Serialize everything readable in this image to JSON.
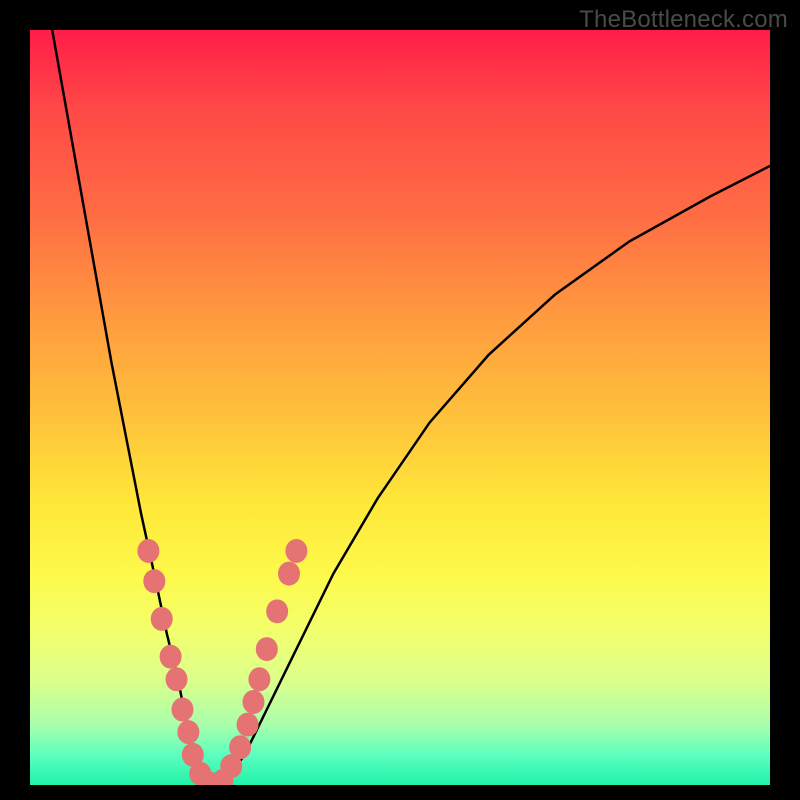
{
  "watermark": "TheBottleneck.com",
  "colors": {
    "background": "#000000",
    "curve_stroke": "#000000",
    "marker_fill": "#e57374",
    "gradient_top": "#ff1d48",
    "gradient_mid": "#ffe83a",
    "gradient_bottom": "#20f2a9"
  },
  "chart_data": {
    "type": "line",
    "title": "",
    "xlabel": "",
    "ylabel": "",
    "xlim": [
      0,
      100
    ],
    "ylim": [
      0,
      100
    ],
    "series": [
      {
        "name": "curve",
        "x": [
          3,
          5,
          7,
          9,
          11,
          13,
          15,
          17,
          18.5,
          20,
          21,
          22,
          23,
          24,
          26,
          29,
          32,
          36,
          41,
          47,
          54,
          62,
          71,
          81,
          92,
          100
        ],
        "y": [
          100,
          89,
          78,
          67,
          56,
          46,
          36,
          27,
          20,
          14,
          9,
          5,
          2,
          0,
          0,
          4,
          10,
          18,
          28,
          38,
          48,
          57,
          65,
          72,
          78,
          82
        ]
      }
    ],
    "markers": [
      {
        "x": 16.0,
        "y": 31
      },
      {
        "x": 16.8,
        "y": 27
      },
      {
        "x": 17.8,
        "y": 22
      },
      {
        "x": 19.0,
        "y": 17
      },
      {
        "x": 19.8,
        "y": 14
      },
      {
        "x": 20.6,
        "y": 10
      },
      {
        "x": 21.4,
        "y": 7
      },
      {
        "x": 22.0,
        "y": 4
      },
      {
        "x": 23.0,
        "y": 1.5
      },
      {
        "x": 24.0,
        "y": 0.3
      },
      {
        "x": 25.0,
        "y": 0.0
      },
      {
        "x": 26.0,
        "y": 0.5
      },
      {
        "x": 27.2,
        "y": 2.5
      },
      {
        "x": 28.4,
        "y": 5
      },
      {
        "x": 29.4,
        "y": 8
      },
      {
        "x": 30.2,
        "y": 11
      },
      {
        "x": 31.0,
        "y": 14
      },
      {
        "x": 32.0,
        "y": 18
      },
      {
        "x": 33.4,
        "y": 23
      },
      {
        "x": 35.0,
        "y": 28
      },
      {
        "x": 36.0,
        "y": 31
      }
    ]
  }
}
